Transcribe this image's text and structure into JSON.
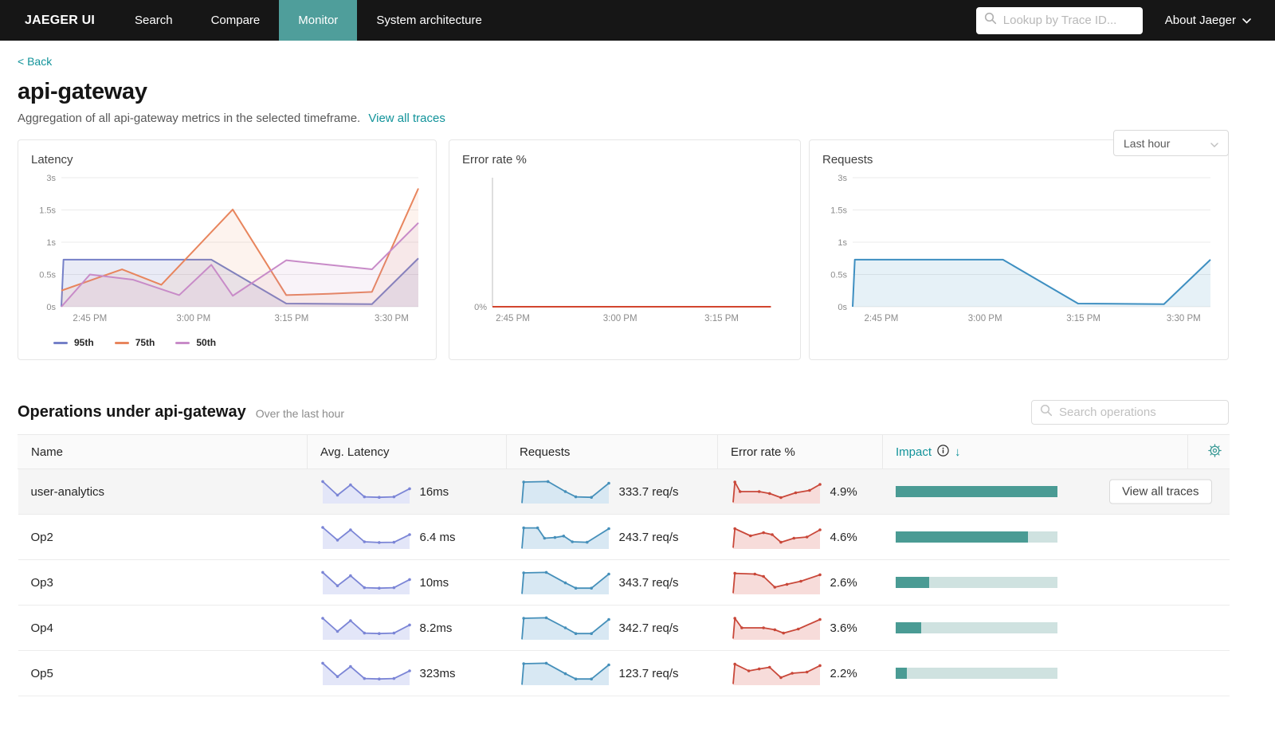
{
  "nav": {
    "brand": "JAEGER UI",
    "items": [
      {
        "label": "Search",
        "active": false
      },
      {
        "label": "Compare",
        "active": false
      },
      {
        "label": "Monitor",
        "active": true
      },
      {
        "label": "System architecture",
        "active": false
      }
    ],
    "trace_search_placeholder": "Lookup by Trace ID...",
    "about_label": "About Jaeger"
  },
  "header": {
    "back": "< Back",
    "title": "api-gateway",
    "subtitle": "Aggregation of all api-gateway metrics in the selected timeframe.",
    "view_all_traces": "View all traces",
    "timeframe": "Last hour"
  },
  "colors": {
    "accent_teal": "#11939a",
    "nav_active": "#4f9e9b",
    "impact_fill": "#4a9b94",
    "impact_track": "#cfe2e0"
  },
  "chart_data": [
    {
      "type": "line",
      "title": "Latency",
      "y_scale": {
        "domain": [
          0,
          0.5,
          1,
          1.5,
          3
        ],
        "range": [
          0,
          0.25,
          0.5,
          0.75,
          1
        ]
      },
      "y_ticks": [
        {
          "label": "3s",
          "frac": 1
        },
        {
          "label": "1.5s",
          "frac": 0.75
        },
        {
          "label": "1s",
          "frac": 0.5
        },
        {
          "label": "0.5s",
          "frac": 0.25
        },
        {
          "label": "0s",
          "frac": 0
        }
      ],
      "x_ticks": [
        {
          "label": "2:45 PM",
          "frac": 0.08
        },
        {
          "label": "3:00 PM",
          "frac": 0.37
        },
        {
          "label": "3:15 PM",
          "frac": 0.645
        },
        {
          "label": "3:30 PM",
          "frac": 0.925
        }
      ],
      "grid": true,
      "series": [
        {
          "name": "95th",
          "color": "#7580c8",
          "fill": "rgba(117,128,200,0.16)",
          "points": [
            [
              0,
              0
            ],
            [
              0.006,
              0.73
            ],
            [
              0.42,
              0.73
            ],
            [
              0.63,
              0.05
            ],
            [
              0.87,
              0.04
            ],
            [
              1,
              0.75
            ]
          ]
        },
        {
          "name": "75th",
          "color": "#e8855d",
          "fill": "rgba(232,133,93,0.10)",
          "points": [
            [
              0,
              0.25
            ],
            [
              0.17,
              0.58
            ],
            [
              0.28,
              0.34
            ],
            [
              0.48,
              1.52
            ],
            [
              0.63,
              0.18
            ],
            [
              0.75,
              0.2
            ],
            [
              0.87,
              0.23
            ],
            [
              1,
              2.5
            ]
          ]
        },
        {
          "name": "50th",
          "color": "#c88bc8",
          "fill": "rgba(200,139,200,0.10)",
          "points": [
            [
              0,
              0
            ],
            [
              0.08,
              0.5
            ],
            [
              0.2,
              0.42
            ],
            [
              0.33,
              0.18
            ],
            [
              0.42,
              0.65
            ],
            [
              0.48,
              0.17
            ],
            [
              0.63,
              0.72
            ],
            [
              0.75,
              0.65
            ],
            [
              0.87,
              0.58
            ],
            [
              1,
              1.3
            ]
          ]
        }
      ],
      "legend": [
        {
          "label": "95th",
          "color": "#7580c8"
        },
        {
          "label": "75th",
          "color": "#e8855d"
        },
        {
          "label": "50th",
          "color": "#c88bc8"
        }
      ]
    },
    {
      "type": "line",
      "title": "Error rate %",
      "y_scale": {
        "domain": [
          0,
          100
        ],
        "range": [
          0,
          1
        ]
      },
      "y_ticks": [
        {
          "label": "0%",
          "frac": 0
        }
      ],
      "x_ticks": [
        {
          "label": "2:45 PM",
          "frac": 0.07
        },
        {
          "label": "3:00 PM",
          "frac": 0.44
        },
        {
          "label": "3:15 PM",
          "frac": 0.79
        }
      ],
      "grid": false,
      "y_axis_line": true,
      "series": [
        {
          "name": "error rate",
          "color": "#d2452e",
          "fill": null,
          "points": [
            [
              0,
              0
            ],
            [
              0.96,
              0
            ]
          ]
        }
      ]
    },
    {
      "type": "line",
      "title": "Requests",
      "y_scale": {
        "domain": [
          0,
          0.5,
          1,
          1.5,
          3
        ],
        "range": [
          0,
          0.25,
          0.5,
          0.75,
          1
        ]
      },
      "y_ticks": [
        {
          "label": "3s",
          "frac": 1
        },
        {
          "label": "1.5s",
          "frac": 0.75
        },
        {
          "label": "1s",
          "frac": 0.5
        },
        {
          "label": "0.5s",
          "frac": 0.25
        },
        {
          "label": "0s",
          "frac": 0
        }
      ],
      "x_ticks": [
        {
          "label": "2:45 PM",
          "frac": 0.08
        },
        {
          "label": "3:00 PM",
          "frac": 0.37
        },
        {
          "label": "3:15 PM",
          "frac": 0.645
        },
        {
          "label": "3:30 PM",
          "frac": 0.925
        }
      ],
      "grid": true,
      "series": [
        {
          "name": "requests",
          "color": "#3e8fc1",
          "fill": "rgba(62,143,193,0.13)",
          "points": [
            [
              0,
              0
            ],
            [
              0.006,
              0.73
            ],
            [
              0.42,
              0.73
            ],
            [
              0.63,
              0.05
            ],
            [
              0.87,
              0.04
            ],
            [
              1,
              0.73
            ]
          ]
        }
      ]
    }
  ],
  "operations": {
    "title": "Operations under api-gateway",
    "subtitle": "Over the last hour",
    "search_placeholder": "Search operations",
    "view_traces_button": "View all traces",
    "columns": [
      "Name",
      "Avg. Latency",
      "Requests",
      "Error rate %",
      "Impact"
    ],
    "rows": [
      {
        "name": "user-analytics",
        "latency": "16ms",
        "requests": "333.7 req/s",
        "error_rate": "4.9%",
        "impact_pct": 100,
        "highlighted": true,
        "has_button": true,
        "spark_latency": [
          [
            0,
            0.92
          ],
          [
            0.17,
            0.35
          ],
          [
            0.32,
            0.78
          ],
          [
            0.48,
            0.28
          ],
          [
            0.65,
            0.26
          ],
          [
            0.82,
            0.28
          ],
          [
            1,
            0.62
          ]
        ],
        "spark_requests": [
          [
            0,
            0.02
          ],
          [
            0.02,
            0.9
          ],
          [
            0.3,
            0.92
          ],
          [
            0.5,
            0.5
          ],
          [
            0.62,
            0.28
          ],
          [
            0.8,
            0.26
          ],
          [
            1,
            0.85
          ]
        ],
        "spark_error": [
          [
            0,
            0.05
          ],
          [
            0.02,
            0.9
          ],
          [
            0.08,
            0.5
          ],
          [
            0.3,
            0.5
          ],
          [
            0.42,
            0.42
          ],
          [
            0.55,
            0.25
          ],
          [
            0.72,
            0.45
          ],
          [
            0.88,
            0.55
          ],
          [
            1,
            0.8
          ]
        ]
      },
      {
        "name": "Op2",
        "latency": "6.4 ms",
        "requests": "243.7 req/s",
        "error_rate": "4.6%",
        "impact_pct": 82,
        "highlighted": false,
        "has_button": false,
        "spark_latency": [
          [
            0,
            0.9
          ],
          [
            0.17,
            0.37
          ],
          [
            0.32,
            0.8
          ],
          [
            0.48,
            0.3
          ],
          [
            0.65,
            0.27
          ],
          [
            0.82,
            0.28
          ],
          [
            1,
            0.6
          ]
        ],
        "spark_requests": [
          [
            0,
            0.02
          ],
          [
            0.02,
            0.88
          ],
          [
            0.18,
            0.88
          ],
          [
            0.26,
            0.45
          ],
          [
            0.38,
            0.48
          ],
          [
            0.48,
            0.54
          ],
          [
            0.58,
            0.3
          ],
          [
            0.75,
            0.28
          ],
          [
            1,
            0.85
          ]
        ],
        "spark_error": [
          [
            0,
            0.05
          ],
          [
            0.02,
            0.85
          ],
          [
            0.2,
            0.55
          ],
          [
            0.35,
            0.68
          ],
          [
            0.45,
            0.6
          ],
          [
            0.55,
            0.28
          ],
          [
            0.7,
            0.45
          ],
          [
            0.85,
            0.5
          ],
          [
            1,
            0.8
          ]
        ]
      },
      {
        "name": "Op3",
        "latency": "10ms",
        "requests": "343.7 req/s",
        "error_rate": "2.6%",
        "impact_pct": 21,
        "highlighted": false,
        "has_button": false,
        "spark_latency": [
          [
            0,
            0.92
          ],
          [
            0.17,
            0.36
          ],
          [
            0.32,
            0.78
          ],
          [
            0.48,
            0.28
          ],
          [
            0.65,
            0.26
          ],
          [
            0.82,
            0.28
          ],
          [
            1,
            0.62
          ]
        ],
        "spark_requests": [
          [
            0,
            0.02
          ],
          [
            0.02,
            0.9
          ],
          [
            0.28,
            0.92
          ],
          [
            0.5,
            0.48
          ],
          [
            0.62,
            0.26
          ],
          [
            0.8,
            0.26
          ],
          [
            1,
            0.85
          ]
        ],
        "spark_error": [
          [
            0,
            0.05
          ],
          [
            0.02,
            0.88
          ],
          [
            0.25,
            0.85
          ],
          [
            0.35,
            0.75
          ],
          [
            0.48,
            0.3
          ],
          [
            0.62,
            0.42
          ],
          [
            0.78,
            0.55
          ],
          [
            1,
            0.82
          ]
        ]
      },
      {
        "name": "Op4",
        "latency": "8.2ms",
        "requests": "342.7 req/s",
        "error_rate": "3.6%",
        "impact_pct": 16,
        "highlighted": false,
        "has_button": false,
        "spark_latency": [
          [
            0,
            0.9
          ],
          [
            0.17,
            0.35
          ],
          [
            0.32,
            0.8
          ],
          [
            0.48,
            0.28
          ],
          [
            0.65,
            0.26
          ],
          [
            0.82,
            0.28
          ],
          [
            1,
            0.62
          ]
        ],
        "spark_requests": [
          [
            0,
            0.02
          ],
          [
            0.02,
            0.9
          ],
          [
            0.28,
            0.92
          ],
          [
            0.5,
            0.5
          ],
          [
            0.62,
            0.26
          ],
          [
            0.8,
            0.26
          ],
          [
            1,
            0.85
          ]
        ],
        "spark_error": [
          [
            0,
            0.05
          ],
          [
            0.02,
            0.9
          ],
          [
            0.1,
            0.5
          ],
          [
            0.35,
            0.5
          ],
          [
            0.48,
            0.42
          ],
          [
            0.58,
            0.28
          ],
          [
            0.75,
            0.45
          ],
          [
            1,
            0.85
          ]
        ]
      },
      {
        "name": "Op5",
        "latency": "323ms",
        "requests": "123.7 req/s",
        "error_rate": "2.2%",
        "impact_pct": 7,
        "highlighted": false,
        "has_button": false,
        "spark_latency": [
          [
            0,
            0.92
          ],
          [
            0.17,
            0.36
          ],
          [
            0.32,
            0.78
          ],
          [
            0.48,
            0.28
          ],
          [
            0.65,
            0.26
          ],
          [
            0.82,
            0.28
          ],
          [
            1,
            0.6
          ]
        ],
        "spark_requests": [
          [
            0,
            0.02
          ],
          [
            0.02,
            0.9
          ],
          [
            0.28,
            0.92
          ],
          [
            0.5,
            0.48
          ],
          [
            0.62,
            0.26
          ],
          [
            0.8,
            0.26
          ],
          [
            1,
            0.85
          ]
        ],
        "spark_error": [
          [
            0,
            0.05
          ],
          [
            0.02,
            0.88
          ],
          [
            0.18,
            0.6
          ],
          [
            0.3,
            0.68
          ],
          [
            0.42,
            0.75
          ],
          [
            0.55,
            0.32
          ],
          [
            0.68,
            0.5
          ],
          [
            0.85,
            0.55
          ],
          [
            1,
            0.82
          ]
        ]
      }
    ],
    "spark_colors": {
      "latency": {
        "line": "#7b85d6",
        "fill": "#e3e6f8"
      },
      "requests": {
        "line": "#4690ba",
        "fill": "#d8e8f3"
      },
      "error": {
        "line": "#c9483a",
        "fill": "#f7dcda"
      }
    }
  }
}
